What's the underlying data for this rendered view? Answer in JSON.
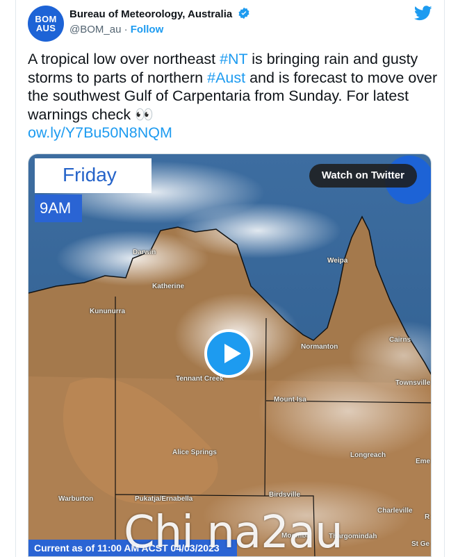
{
  "account": {
    "avatar_line1": "BOM",
    "avatar_line2": "AUS",
    "name": "Bureau of Meteorology, Australia",
    "handle": "@BOM_au",
    "separator": "·",
    "follow_label": "Follow"
  },
  "tweet": {
    "text_1": "A tropical low over northeast ",
    "tag_nt": "#NT",
    "text_2": "  is bringing  rain and gusty storms to parts of northern ",
    "tag_aust": "#Aust",
    "text_3": " and is forecast to move over the southwest Gulf of Carpentaria from Sunday. For latest warnings check 👀",
    "link": "ow.ly/Y7Bu50N8NQM"
  },
  "media": {
    "day": "Friday",
    "time": "9AM",
    "watch_label": "Watch on Twitter",
    "footer": "Current as of 11:00 AM ACST 04/03/2023",
    "places": [
      "Darwin",
      "Weipa",
      "Katherine",
      "Kununurra",
      "Normanton",
      "Cairns",
      "Tennant Creek",
      "Townsville",
      "Mount Isa",
      "Longreach",
      "Eme",
      "Alice Springs",
      "Birdsville",
      "Warburton",
      "Pukatja/Ernabella",
      "Charleville",
      "Moomba",
      "Thargomindah",
      "R",
      "St Ge"
    ]
  },
  "watermark": "Chi na2au",
  "colors": {
    "accent": "#1d9bf0",
    "bom_blue": "#1d63d6"
  }
}
